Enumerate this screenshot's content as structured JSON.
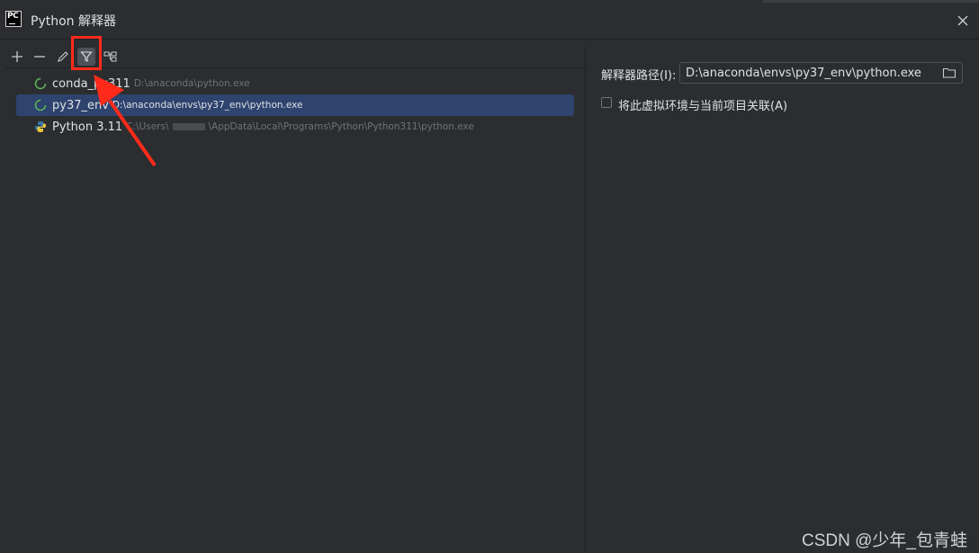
{
  "window": {
    "title": "Python 解释器",
    "logo_text": "PC",
    "close_icon": "close-icon"
  },
  "toolbar": {
    "items": [
      {
        "name": "add",
        "icon": "plus-icon"
      },
      {
        "name": "remove",
        "icon": "minus-icon"
      },
      {
        "name": "edit",
        "icon": "pencil-icon"
      },
      {
        "name": "filter",
        "icon": "filter-icon",
        "active": true
      },
      {
        "name": "show-paths",
        "icon": "tree-icon"
      }
    ]
  },
  "interpreters": [
    {
      "name": "conda_py311",
      "path": "D:\\anaconda\\python.exe",
      "icon": "conda-spinner-icon",
      "selected": false
    },
    {
      "name": "py37_env",
      "path": "D:\\anaconda\\envs\\py37_env\\python.exe",
      "icon": "conda-spinner-icon",
      "selected": true
    },
    {
      "name": "Python 3.11",
      "path_prefix": "C:\\Users\\",
      "path_suffix": "\\AppData\\Local\\Programs\\Python\\Python311\\python.exe",
      "icon": "python-logo-icon",
      "selected": false
    }
  ],
  "details": {
    "path_label": "解释器路径(I):",
    "path_value": "D:\\anaconda\\envs\\py37_env\\python.exe",
    "associate_label": "将此虚拟环境与当前项目关联(A)",
    "associate_checked": false
  },
  "watermark": "CSDN @少年_包青蛙",
  "colors": {
    "background": "#2b2d30",
    "selection": "#2e436e",
    "annotation": "#ff2a1a",
    "conda_green": "#5fb85a"
  }
}
